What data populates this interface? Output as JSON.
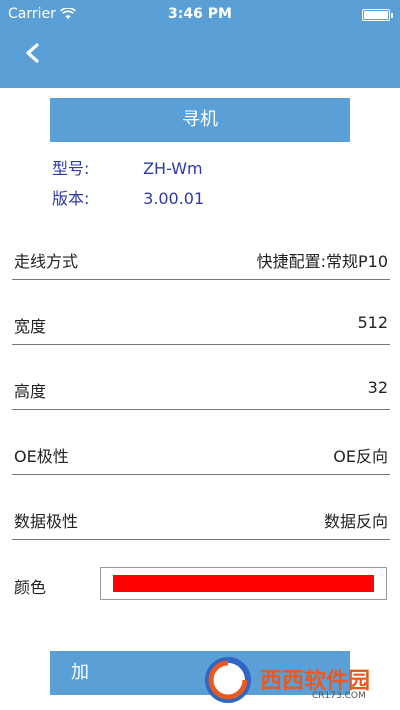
{
  "status_bar": {
    "carrier": "Carrier",
    "time": "3:46 PM"
  },
  "nav": {
    "back_icon": "chevron-left-icon"
  },
  "find_button": {
    "label": "寻机"
  },
  "device": {
    "model_label": "型号:",
    "model_value": "ZH-Wm",
    "version_label": "版本:",
    "version_value": "3.00.01"
  },
  "settings": [
    {
      "label": "走线方式",
      "value": "快捷配置:常规P10"
    },
    {
      "label": "宽度",
      "value": "512"
    },
    {
      "label": "高度",
      "value": "32"
    },
    {
      "label": "OE极性",
      "value": "OE反向"
    },
    {
      "label": "数据极性",
      "value": "数据反向"
    }
  ],
  "color": {
    "label": "颜色",
    "value": "#ff0000"
  },
  "add_button": {
    "label": "加"
  },
  "watermark": {
    "brand": "西西软件园",
    "site": "CR173.COM"
  },
  "theme": {
    "accent": "#5aa0d6",
    "info_text": "#2f3aa8"
  }
}
